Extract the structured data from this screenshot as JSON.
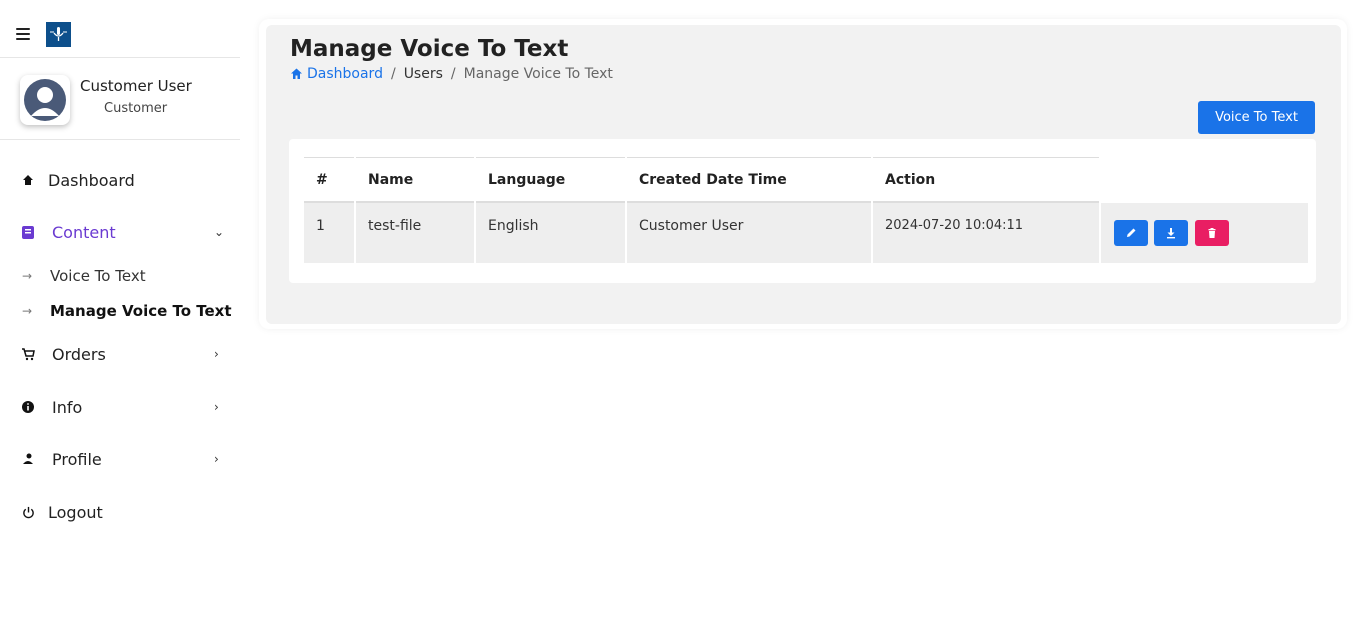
{
  "sidebar": {
    "user": {
      "name": "Customer User",
      "role": "Customer"
    },
    "items": [
      {
        "label": "Dashboard",
        "icon": "home-icon"
      },
      {
        "label": "Content",
        "icon": "content-icon",
        "expanded": true,
        "children": [
          {
            "label": "Voice To Text"
          },
          {
            "label": "Manage Voice To Text",
            "current": true
          }
        ]
      },
      {
        "label": "Orders",
        "icon": "cart-icon"
      },
      {
        "label": "Info",
        "icon": "info-icon"
      },
      {
        "label": "Profile",
        "icon": "user-icon"
      },
      {
        "label": "Logout",
        "icon": "power-icon"
      }
    ]
  },
  "page": {
    "title": "Manage Voice To Text",
    "breadcrumb": {
      "home": "Dashboard",
      "users": "Users",
      "current": "Manage Voice To Text"
    },
    "primary_button": "Voice To Text"
  },
  "table": {
    "headers": [
      "#",
      "Name",
      "Language",
      "Created Date Time",
      "Action"
    ],
    "rows": [
      {
        "num": "1",
        "name": "test-file",
        "language": "English",
        "created_by": "Customer User",
        "datetime": "2024-07-20 10:04:11"
      }
    ]
  },
  "colors": {
    "primary": "#1a73e8",
    "danger": "#e91e63",
    "accent": "#6a3ad1"
  }
}
